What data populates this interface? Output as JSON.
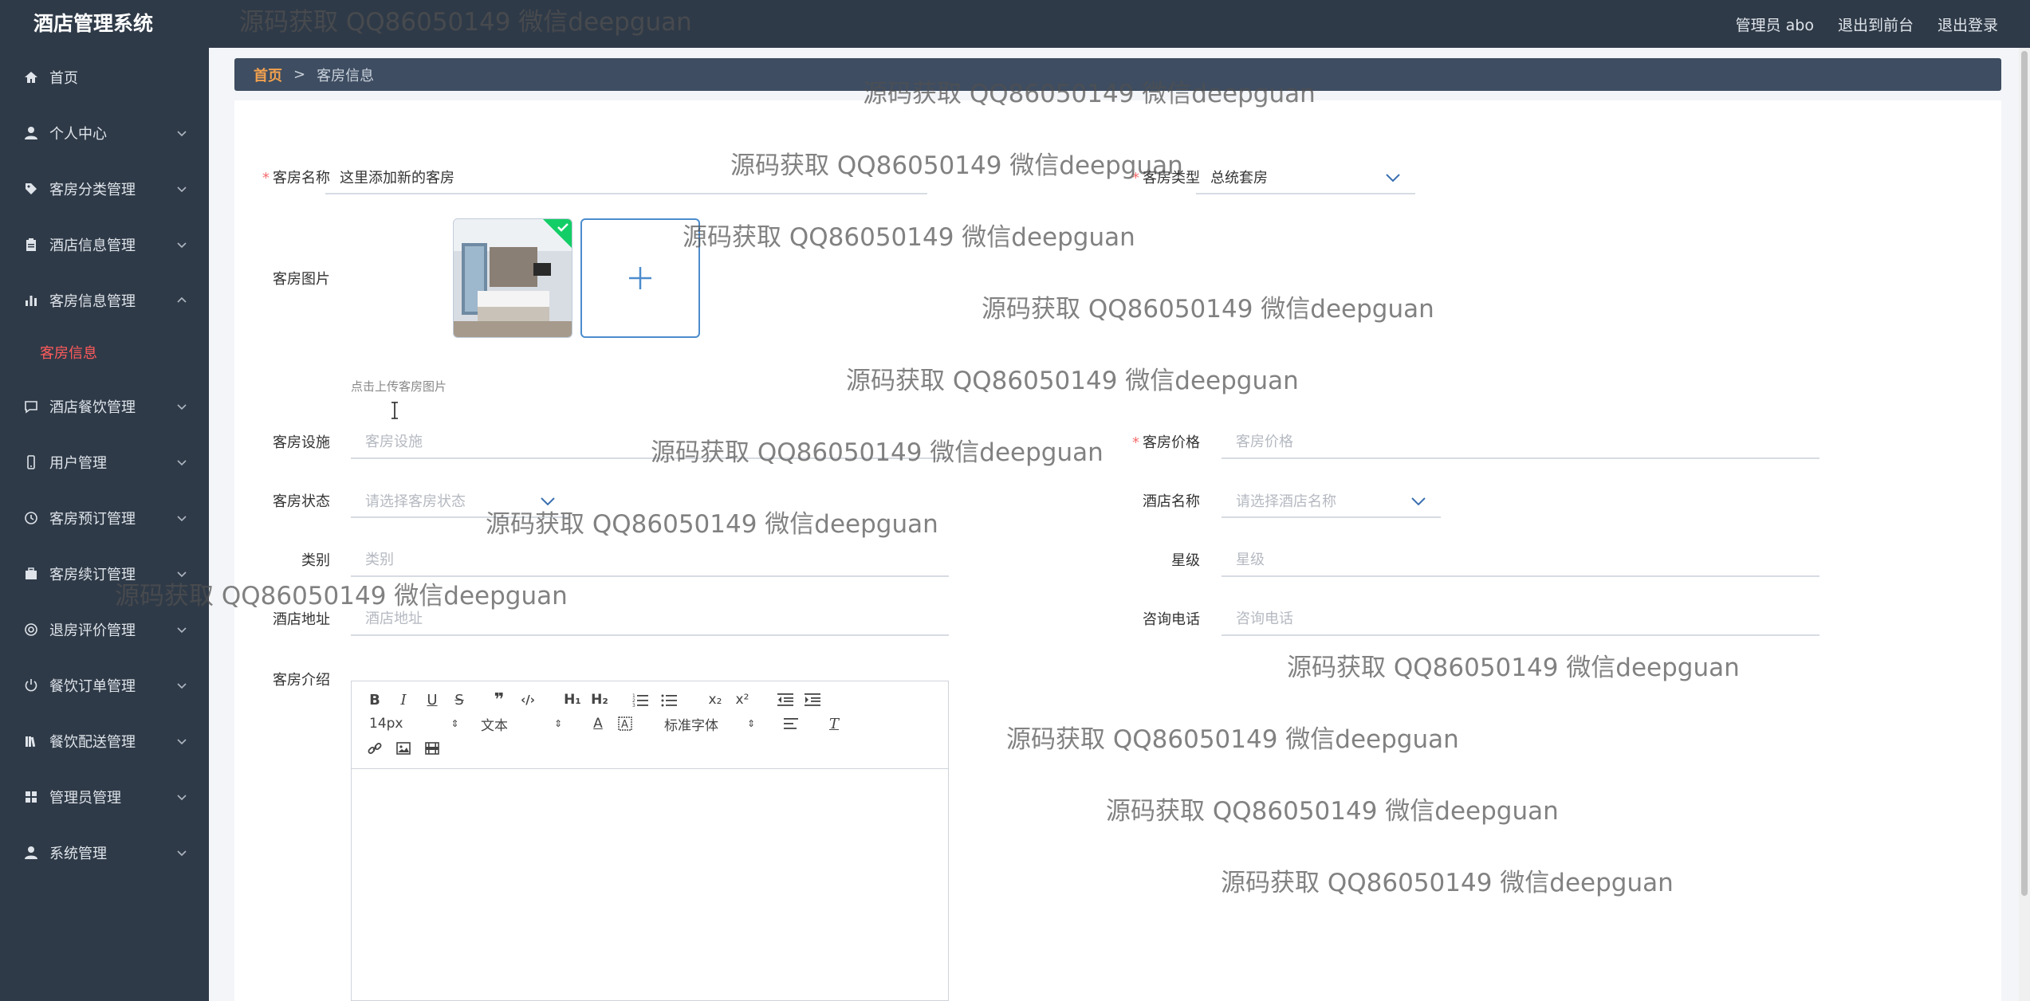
{
  "header": {
    "brand": "酒店管理系统",
    "user": "管理员 abo",
    "front_link": "退出到前台",
    "logout": "退出登录"
  },
  "sidebar": {
    "items": [
      {
        "label": "首页",
        "icon": "home-icon"
      },
      {
        "label": "个人中心",
        "icon": "user-icon"
      },
      {
        "label": "客房分类管理",
        "icon": "tag-icon"
      },
      {
        "label": "酒店信息管理",
        "icon": "clipboard-icon"
      },
      {
        "label": "客房信息管理",
        "icon": "bar-chart-icon"
      },
      {
        "label": "客房信息",
        "sub": true
      },
      {
        "label": "酒店餐饮管理",
        "icon": "message-icon"
      },
      {
        "label": "用户管理",
        "icon": "phone-icon"
      },
      {
        "label": "客房预订管理",
        "icon": "clock-icon"
      },
      {
        "label": "客房续订管理",
        "icon": "briefcase-icon"
      },
      {
        "label": "退房评价管理",
        "icon": "target-icon"
      },
      {
        "label": "餐饮订单管理",
        "icon": "power-icon"
      },
      {
        "label": "餐饮配送管理",
        "icon": "books-icon"
      },
      {
        "label": "管理员管理",
        "icon": "grid-icon"
      },
      {
        "label": "系统管理",
        "icon": "user-icon"
      }
    ]
  },
  "breadcrumb": {
    "home": "首页",
    "separator": ">",
    "current": "客房信息"
  },
  "form": {
    "room_name": {
      "label": "客房名称",
      "value": "这里添加新的客房"
    },
    "room_type": {
      "label": "客房类型",
      "value": "总统套房"
    },
    "room_image": {
      "label": "客房图片",
      "hint": "点击上传客房图片"
    },
    "facilities": {
      "label": "客房设施",
      "placeholder": "客房设施"
    },
    "price": {
      "label": "客房价格",
      "placeholder": "客房价格"
    },
    "status": {
      "label": "客房状态",
      "placeholder": "请选择客房状态"
    },
    "hotel_name": {
      "label": "酒店名称",
      "placeholder": "请选择酒店名称"
    },
    "category": {
      "label": "类别",
      "placeholder": "类别"
    },
    "star": {
      "label": "星级",
      "placeholder": "星级"
    },
    "address": {
      "label": "酒店地址",
      "placeholder": "酒店地址"
    },
    "phone": {
      "label": "咨询电话",
      "placeholder": "咨询电话"
    },
    "intro": {
      "label": "客房介绍"
    }
  },
  "editor": {
    "font_size": "14px",
    "text_style": "文本",
    "font_family": "标准字体"
  },
  "watermark": {
    "text": "源码获取 QQ86050149 微信deepguan"
  },
  "colors": {
    "sidebar_bg": "#2f3a48",
    "active_sub": "#ff5b5b",
    "breadcrumb_home": "#f3a14e",
    "required": "#f56c6c",
    "accent_blue": "#4c8ccd"
  }
}
